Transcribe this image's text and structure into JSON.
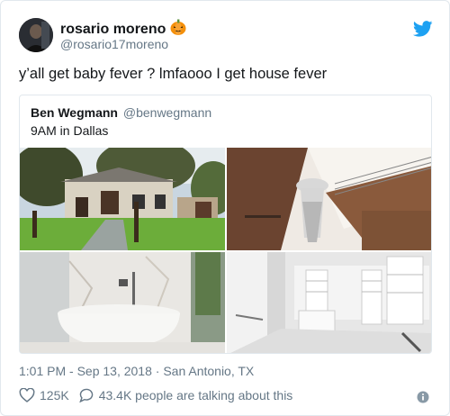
{
  "author": {
    "name": "rosario moreno",
    "emoji": "🎃",
    "handle": "@rosario17moreno"
  },
  "tweet": {
    "text": "y’all get baby fever ? lmfaooo I get house fever"
  },
  "quoted": {
    "name": "Ben Wegmann",
    "handle": "@benwegmann",
    "text": "9AM in Dallas",
    "photos": [
      "house-exterior",
      "staircase-chandelier",
      "bathtub",
      "walk-in-closet"
    ]
  },
  "meta": {
    "timestamp": "1:01 PM - Sep 13, 2018",
    "separator": "·",
    "location": "San Antonio, TX"
  },
  "actions": {
    "likes": "125K",
    "replies": "43.4K people are talking about this"
  },
  "colors": {
    "twitter_blue": "#1da1f2",
    "muted": "#657786",
    "border": "#e1e8ed"
  }
}
